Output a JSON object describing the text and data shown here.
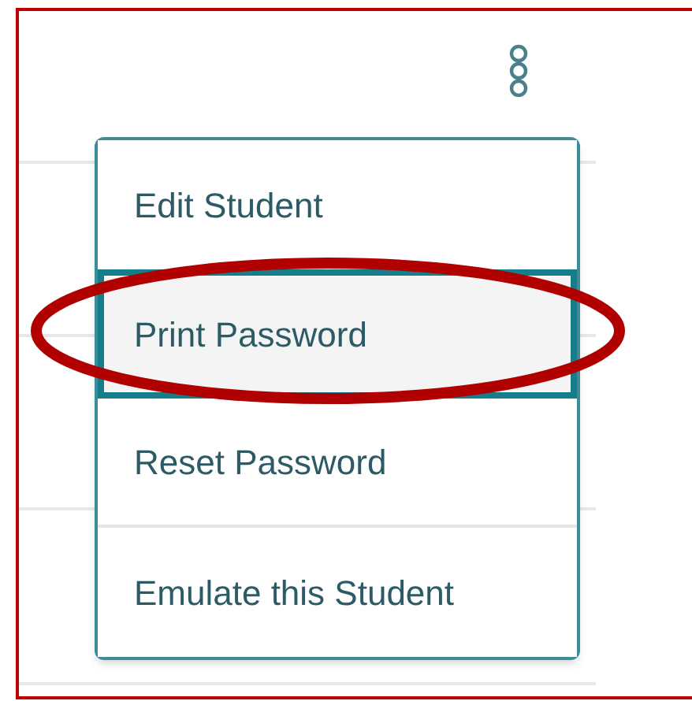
{
  "menu": {
    "items": [
      {
        "label": "Edit Student",
        "selected": false
      },
      {
        "label": "Print Password",
        "selected": true
      },
      {
        "label": "Reset Password",
        "selected": false
      },
      {
        "label": "Emulate this Student",
        "selected": false
      }
    ]
  },
  "annotation": {
    "kind": "ellipse"
  }
}
